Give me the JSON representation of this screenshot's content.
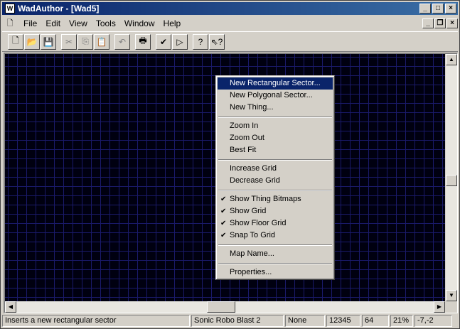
{
  "window": {
    "title": "WadAuthor - [Wad5]",
    "caption_buttons": [
      "_",
      "□",
      "×"
    ]
  },
  "menubar": {
    "items": [
      "File",
      "Edit",
      "View",
      "Tools",
      "Window",
      "Help"
    ],
    "mdi_buttons": [
      "_",
      "❐",
      "×"
    ]
  },
  "toolbar": {
    "buttons": [
      {
        "icon": "new-document-icon",
        "glyph": "🗋"
      },
      {
        "icon": "open-folder-icon",
        "glyph": "📂"
      },
      {
        "icon": "save-disk-icon",
        "glyph": "💾"
      },
      {
        "icon": "cut-icon",
        "glyph": "✂"
      },
      {
        "icon": "copy-icon",
        "glyph": "⎘"
      },
      {
        "icon": "paste-icon",
        "glyph": "📋"
      },
      {
        "icon": "undo-icon",
        "glyph": "↶"
      },
      {
        "icon": "print-icon",
        "glyph": "🖶"
      },
      {
        "icon": "check-icon",
        "glyph": "✔"
      },
      {
        "icon": "run-icon",
        "glyph": "▷"
      },
      {
        "icon": "help-icon",
        "glyph": "?"
      },
      {
        "icon": "context-help-icon",
        "glyph": "⇖?"
      }
    ]
  },
  "context_menu": {
    "items": [
      {
        "label": "New Rectangular Sector...",
        "checked": false,
        "highlighted": true
      },
      {
        "label": "New Polygonal Sector...",
        "checked": false
      },
      {
        "label": "New Thing...",
        "checked": false
      },
      {
        "separator": true
      },
      {
        "label": "Zoom In",
        "checked": false
      },
      {
        "label": "Zoom Out",
        "checked": false
      },
      {
        "label": "Best Fit",
        "checked": false
      },
      {
        "separator": true
      },
      {
        "label": "Increase Grid",
        "checked": false
      },
      {
        "label": "Decrease Grid",
        "checked": false
      },
      {
        "separator": true
      },
      {
        "label": "Show Thing Bitmaps",
        "checked": true
      },
      {
        "label": "Show Grid",
        "checked": true
      },
      {
        "label": "Show Floor Grid",
        "checked": true
      },
      {
        "label": "Snap To Grid",
        "checked": true
      },
      {
        "separator": true
      },
      {
        "label": "Map Name...",
        "checked": false
      },
      {
        "separator": true
      },
      {
        "label": "Properties...",
        "checked": false
      }
    ],
    "check_glyph": "✔"
  },
  "statusbar": {
    "message": "Inserts a new rectangular sector",
    "game": "Sonic Robo Blast 2",
    "texture": "None",
    "number": "12345",
    "grid": "64",
    "zoom": "21%",
    "coords": "-7,-2"
  },
  "colors": {
    "map_background": "#000010",
    "grid_lines": "#1a1a6a",
    "highlight": "#0a246a"
  }
}
